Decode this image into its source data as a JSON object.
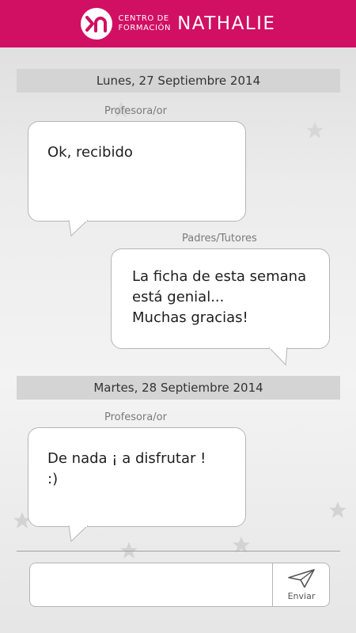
{
  "brand": {
    "subtitle_line1": "CENTRO DE",
    "subtitle_line2": "FORMACIÓN",
    "name": "NATHALIE",
    "color": "#d10f63"
  },
  "conversation": {
    "days": [
      {
        "date": "Lunes, 27 Septiembre 2014",
        "messages": [
          {
            "sender": "Profesora/or",
            "text": "Ok, recibido",
            "side": "left"
          },
          {
            "sender": "Padres/Tutores",
            "text": "La ficha de esta semana\nestá genial...\nMuchas gracias!",
            "side": "right"
          }
        ]
      },
      {
        "date": "Martes, 28 Septiembre 2014",
        "messages": [
          {
            "sender": "Profesora/or",
            "text": "De nada ¡ a disfrutar !\n:)",
            "side": "left"
          }
        ]
      }
    ]
  },
  "composer": {
    "input_value": "",
    "send_label": "Enviar",
    "send_icon": "paper-plane-icon"
  }
}
